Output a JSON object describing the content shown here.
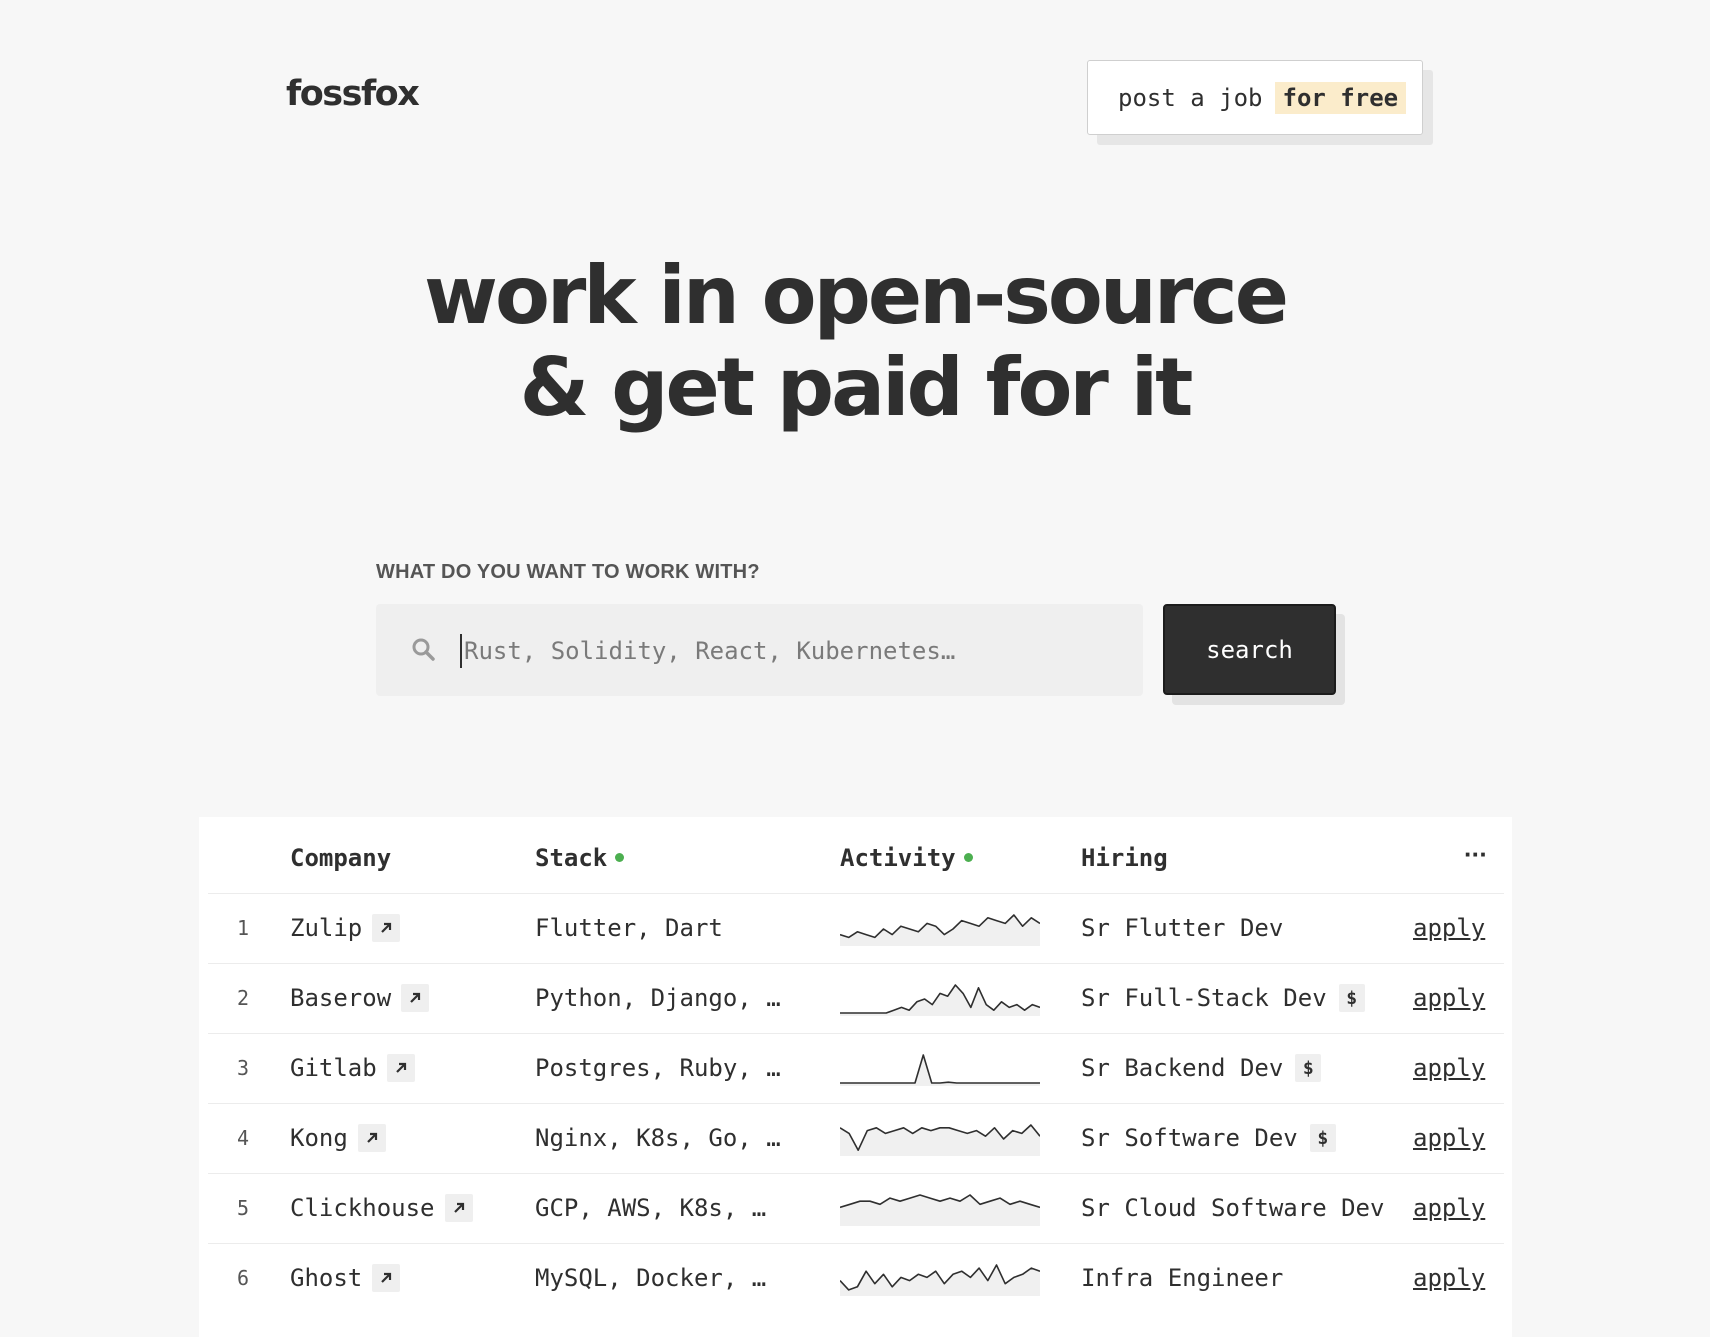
{
  "header": {
    "logo": "fossfox",
    "post_job": {
      "prefix": "post a job",
      "highlight": "for free",
      "highlight_color": "#fbeccb"
    }
  },
  "hero": {
    "line1": "work in open-source",
    "line2": "& get paid for it"
  },
  "search": {
    "label": "WHAT DO YOU WANT TO WORK WITH?",
    "placeholder": "Rust, Solidity, React, Kubernetes…",
    "value": "",
    "button_label": "search"
  },
  "table": {
    "columns": {
      "company": "Company",
      "stack": "Stack",
      "activity": "Activity",
      "hiring": "Hiring",
      "more": "···"
    },
    "accent_dot_color": "#4caf50",
    "rows": [
      {
        "num": "1",
        "company": "Zulip",
        "stack": "Flutter, Dart",
        "hiring": "Sr Flutter Dev",
        "salary": false,
        "apply": "apply",
        "activity": [
          3,
          2,
          4,
          3,
          2,
          5,
          3,
          6,
          5,
          4,
          7,
          6,
          3,
          5,
          8,
          7,
          6,
          9,
          8,
          7,
          10,
          6,
          9,
          7
        ]
      },
      {
        "num": "2",
        "company": "Baserow",
        "stack": "Python, Django, …",
        "hiring": "Sr Full-Stack Dev",
        "salary": true,
        "salary_label": "$",
        "apply": "apply",
        "activity": [
          0,
          0,
          0,
          0,
          0,
          0,
          0,
          1,
          2,
          1,
          4,
          5,
          3,
          7,
          6,
          10,
          7,
          2,
          9,
          3,
          1,
          4,
          2,
          3,
          1,
          3,
          2
        ]
      },
      {
        "num": "3",
        "company": "Gitlab",
        "stack": "Postgres, Ruby, …",
        "hiring": "Sr Backend Dev",
        "salary": true,
        "salary_label": "$",
        "apply": "apply",
        "activity": [
          0,
          0,
          0,
          0,
          0,
          0,
          0,
          0,
          0,
          0,
          10,
          0,
          0,
          0.3,
          0,
          0,
          0,
          0,
          0,
          0,
          0,
          0,
          0,
          0,
          0
        ]
      },
      {
        "num": "4",
        "company": "Kong",
        "stack": "Nginx, K8s, Go, …",
        "hiring": "Sr Software Dev",
        "salary": true,
        "salary_label": "$",
        "apply": "apply",
        "activity": [
          9,
          7,
          1,
          8,
          9,
          7,
          8,
          9,
          7,
          9,
          8,
          9,
          9,
          8,
          7,
          8,
          6,
          9,
          5,
          8,
          7,
          10,
          6
        ]
      },
      {
        "num": "5",
        "company": "Clickhouse",
        "stack": "GCP, AWS, K8s, …",
        "hiring": "Sr Cloud Software Dev",
        "salary": false,
        "apply": "apply",
        "activity": [
          5,
          6,
          7,
          7,
          6,
          8,
          7,
          8,
          9,
          8,
          7,
          8,
          7,
          9,
          6,
          7,
          8,
          6,
          7,
          6,
          5
        ]
      },
      {
        "num": "6",
        "company": "Ghost",
        "stack": "MySQL, Docker, …",
        "hiring": "Infra Engineer",
        "salary": false,
        "apply": "apply",
        "activity": [
          4,
          1,
          2,
          7,
          3,
          6,
          2,
          5,
          4,
          6,
          5,
          7,
          3,
          6,
          7,
          5,
          8,
          4,
          9,
          3,
          5,
          6,
          8,
          7
        ]
      }
    ]
  }
}
